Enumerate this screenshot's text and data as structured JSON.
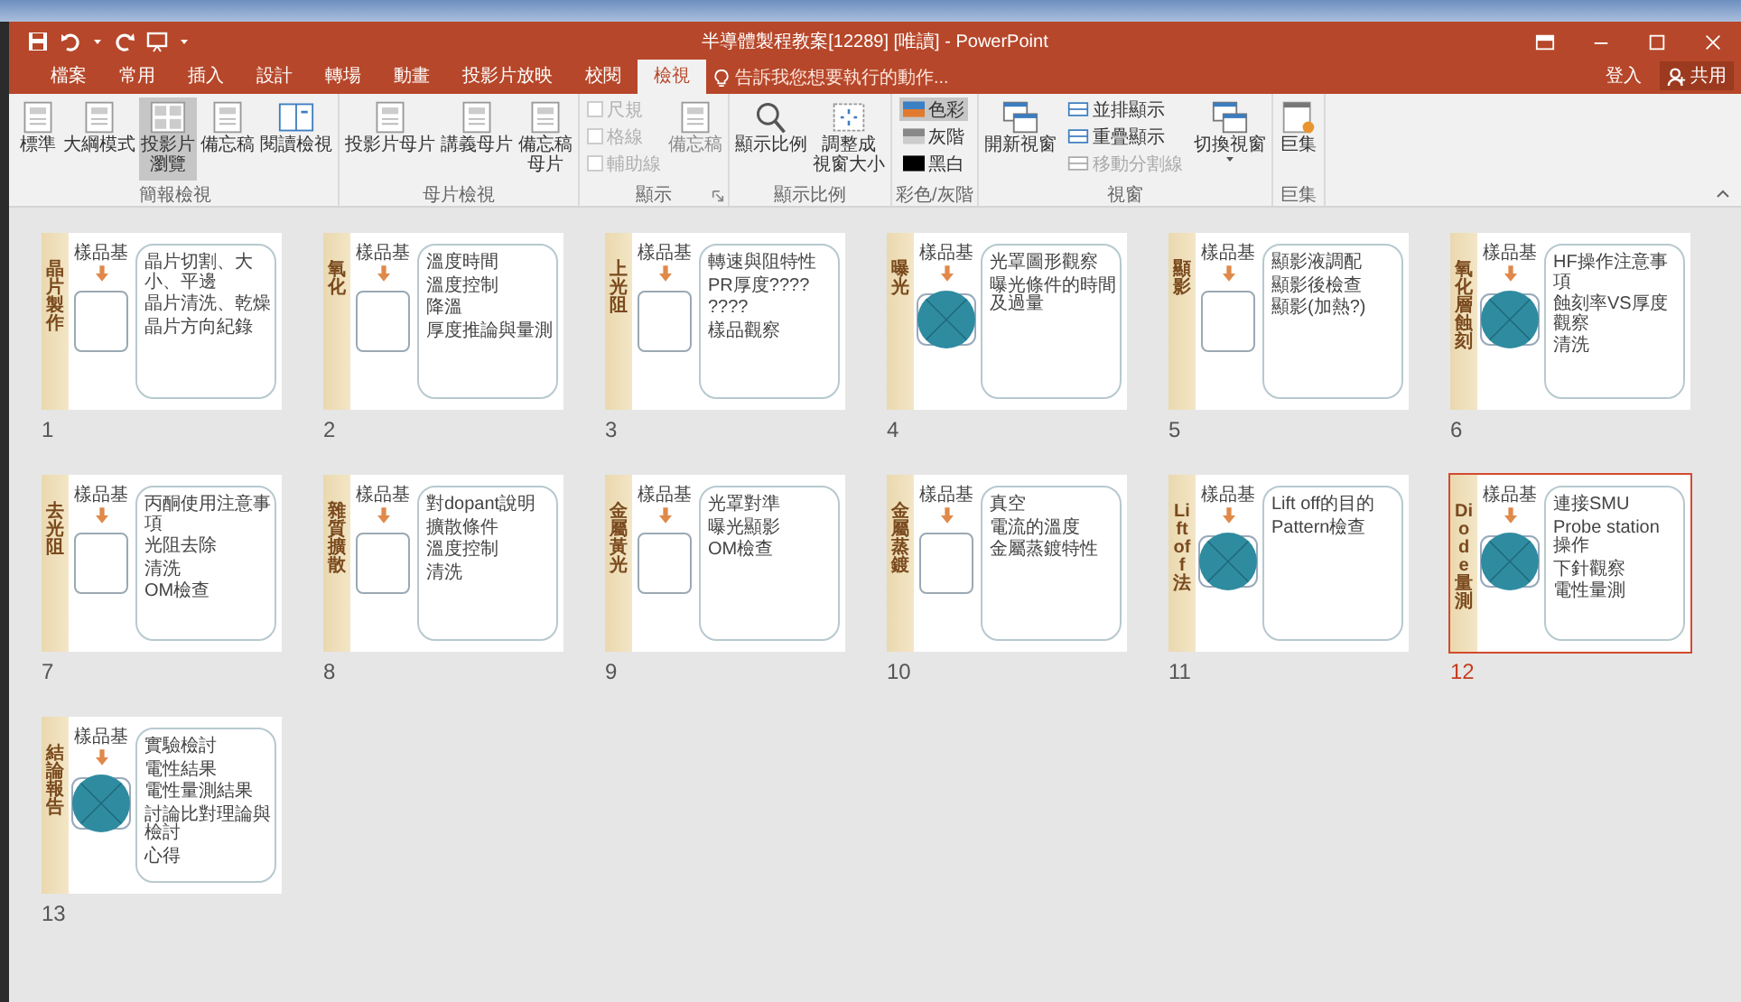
{
  "window": {
    "title": "半導體製程教案[12289] [唯讀] - PowerPoint"
  },
  "tabs": [
    {
      "label": "檔案",
      "selected": false
    },
    {
      "label": "常用",
      "selected": false
    },
    {
      "label": "插入",
      "selected": false
    },
    {
      "label": "設計",
      "selected": false
    },
    {
      "label": "轉場",
      "selected": false
    },
    {
      "label": "動畫",
      "selected": false
    },
    {
      "label": "投影片放映",
      "selected": false
    },
    {
      "label": "校閱",
      "selected": false
    },
    {
      "label": "檢視",
      "selected": true
    }
  ],
  "tell_me": {
    "placeholder": "告訴我您想要執行的動作..."
  },
  "account": {
    "sign_in": "登入",
    "share": "共用"
  },
  "ribbon_groups": [
    {
      "label": "簡報檢視",
      "items": [
        {
          "kind": "large",
          "label": "標準",
          "selected": false,
          "disabled": false
        },
        {
          "kind": "large",
          "label": "大綱模式",
          "selected": false,
          "disabled": false
        },
        {
          "kind": "large",
          "label_lines": [
            "投影片",
            "瀏覽"
          ],
          "selected": true,
          "disabled": false
        },
        {
          "kind": "large",
          "label": "備忘稿",
          "selected": false,
          "disabled": false
        },
        {
          "kind": "large",
          "label": "閱讀檢視",
          "selected": false,
          "disabled": false
        }
      ]
    },
    {
      "label": "母片檢視",
      "items": [
        {
          "kind": "large",
          "label": "投影片母片",
          "selected": false,
          "disabled": false
        },
        {
          "kind": "large",
          "label": "講義母片",
          "selected": false,
          "disabled": false
        },
        {
          "kind": "large",
          "label_lines": [
            "備忘稿",
            "母片"
          ],
          "selected": false,
          "disabled": false
        }
      ]
    },
    {
      "label": "顯示",
      "launcher": true,
      "items": [
        {
          "kind": "stack",
          "entries": [
            {
              "kind": "check",
              "label": "尺規",
              "checked": false,
              "disabled": true
            },
            {
              "kind": "check",
              "label": "格線",
              "checked": false,
              "disabled": true
            },
            {
              "kind": "check",
              "label": "輔助線",
              "checked": false,
              "disabled": true
            }
          ]
        },
        {
          "kind": "large",
          "label": "備忘稿",
          "selected": false,
          "disabled": true
        }
      ]
    },
    {
      "label": "顯示比例",
      "items": [
        {
          "kind": "large",
          "label": "顯示比例",
          "selected": false,
          "disabled": false
        },
        {
          "kind": "large",
          "label_lines": [
            "調整成",
            "視窗大小"
          ],
          "selected": false,
          "disabled": false
        }
      ]
    },
    {
      "label": "彩色/灰階",
      "items": [
        {
          "kind": "stack",
          "entries": [
            {
              "kind": "swatch",
              "label": "色彩",
              "selected": true,
              "disabled": false
            },
            {
              "kind": "swatch",
              "label": "灰階",
              "selected": false,
              "disabled": false
            },
            {
              "kind": "swatch",
              "label": "黑白",
              "selected": false,
              "disabled": false
            }
          ]
        }
      ]
    },
    {
      "label": "視窗",
      "items": [
        {
          "kind": "large",
          "label": "開新視窗",
          "selected": false,
          "disabled": false
        },
        {
          "kind": "stack",
          "entries": [
            {
              "kind": "small",
              "label": "並排顯示",
              "selected": false,
              "disabled": false
            },
            {
              "kind": "small",
              "label": "重疊顯示",
              "selected": false,
              "disabled": false
            },
            {
              "kind": "small",
              "label": "移動分割線",
              "selected": false,
              "disabled": true
            }
          ]
        },
        {
          "kind": "large",
          "label": "切換視窗",
          "selected": false,
          "disabled": false,
          "dropdown": true
        }
      ]
    },
    {
      "label": "巨集",
      "items": [
        {
          "kind": "large",
          "label": "巨集",
          "selected": false,
          "disabled": false
        }
      ]
    }
  ],
  "slides": [
    {
      "number": "1",
      "title": "晶片製作",
      "kind": "box",
      "label": "樣品基",
      "selected": false,
      "bullets": [
        "晶片切割、大小、平邊",
        "晶片清洗、乾燥",
        "晶片方向紀錄"
      ]
    },
    {
      "number": "2",
      "title": "氧化",
      "kind": "box",
      "label": "樣品基",
      "selected": false,
      "bullets": [
        "溫度時間",
        "溫度控制",
        "降溫",
        "厚度推論與量測"
      ]
    },
    {
      "number": "3",
      "title": "上光阻",
      "kind": "box",
      "label": "樣品基",
      "selected": false,
      "bullets": [
        "轉速與阻特性",
        "PR厚度????",
        "????",
        "樣品觀察"
      ]
    },
    {
      "number": "4",
      "title": "曝光",
      "kind": "circle",
      "label": "樣品基",
      "selected": false,
      "bullets": [
        "光罩圖形觀察",
        "曝光條件的時間及過量"
      ]
    },
    {
      "number": "5",
      "title": "顯影",
      "kind": "box",
      "label": "樣品基",
      "selected": false,
      "bullets": [
        "顯影液調配",
        "顯影後檢查",
        "顯影(加熱?)"
      ]
    },
    {
      "number": "6",
      "title": "氧化層蝕刻",
      "kind": "circle",
      "label": "樣品基",
      "selected": false,
      "bullets": [
        "HF操作注意事項",
        "蝕刻率VS厚度觀察",
        "清洗"
      ]
    },
    {
      "number": "7",
      "title": "去光阻",
      "kind": "box",
      "label": "樣品基",
      "selected": false,
      "bullets": [
        "丙酮使用注意事項",
        "光阻去除",
        "清洗",
        "OM檢查"
      ]
    },
    {
      "number": "8",
      "title": "雜質擴散",
      "kind": "box",
      "label": "樣品基",
      "selected": false,
      "bullets": [
        "對dopant說明",
        "擴散條件",
        "溫度控制",
        "清洗"
      ]
    },
    {
      "number": "9",
      "title": "金屬黃光",
      "kind": "box",
      "label": "樣品基",
      "selected": false,
      "bullets": [
        "光罩對準",
        "曝光顯影",
        "OM檢查"
      ]
    },
    {
      "number": "10",
      "title": "金屬蒸鍍",
      "kind": "box",
      "label": "樣品基",
      "selected": false,
      "bullets": [
        "真空",
        "電流的溫度",
        "金屬蒸鍍特性"
      ]
    },
    {
      "number": "11",
      "title": "Lift off法",
      "kind": "circle",
      "label": "樣品基",
      "selected": false,
      "bullets": [
        "Lift off的目的",
        "Pattern檢查"
      ]
    },
    {
      "number": "12",
      "title": "Diode量測",
      "kind": "circle",
      "label": "樣品基",
      "selected": true,
      "bullets": [
        "連接SMU",
        "Probe station 操作",
        "下針觀察",
        "電性量測"
      ]
    },
    {
      "number": "13",
      "title": "結論報告",
      "kind": "circle",
      "label": "樣品基",
      "selected": false,
      "bullets": [
        "實驗檢討",
        "電性結果",
        "電性量測結果",
        "討論比對理論與檢討",
        "心得"
      ]
    }
  ]
}
